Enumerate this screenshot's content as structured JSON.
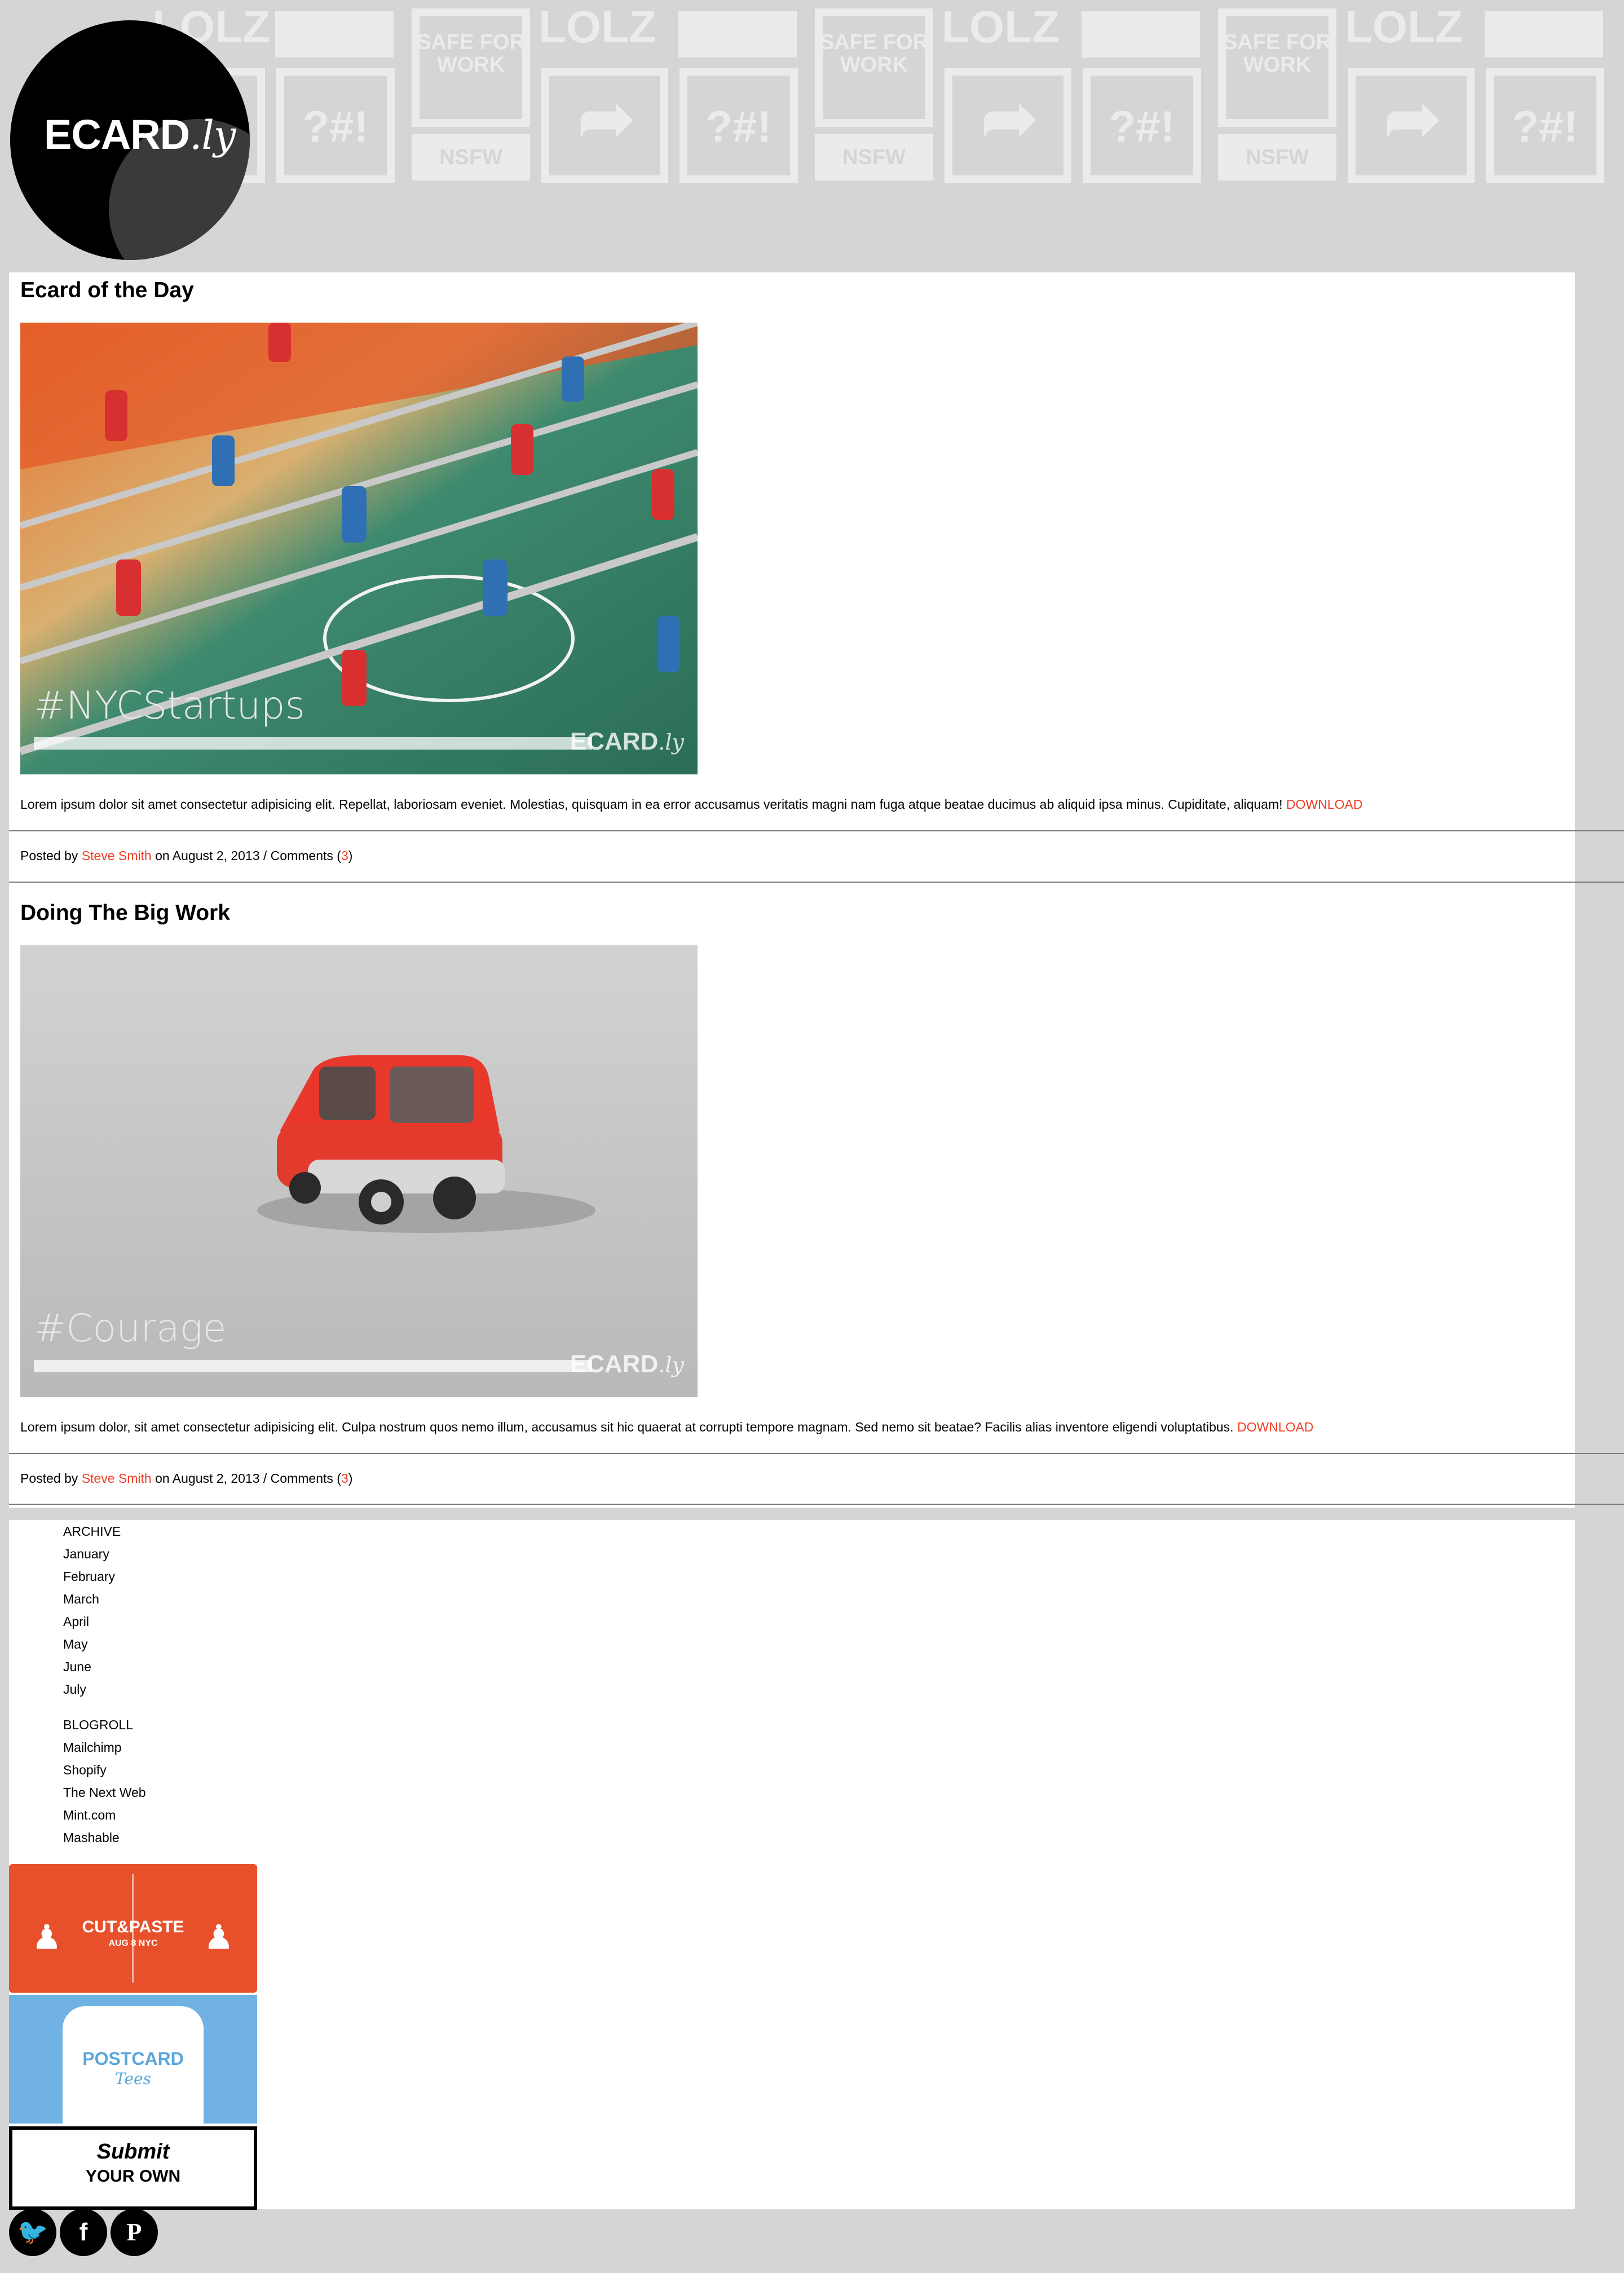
{
  "header": {
    "logo_text": "ECARD",
    "logo_suffix": ".ly",
    "pattern": {
      "lolz": "LOLZ",
      "sfw": "SAFE FOR WORK",
      "nsfw": "NSFW",
      "symbols": "?#!"
    }
  },
  "posts": [
    {
      "title": "Ecard of the Day",
      "image_hashtag": "#NYCStartups",
      "image_watermark": "ECARD",
      "image_watermark_suffix": ".ly",
      "body": "Lorem ipsum dolor sit amet consectetur adipisicing elit. Repellat, laboriosam eveniet. Molestias, quisquam in ea error accusamus veritatis magni nam fuga atque beatae ducimus ab aliquid ipsa minus. Cupiditate, aliquam!",
      "download_label": "DOWNLOAD",
      "meta": {
        "posted_by": "Posted by",
        "author": "Steve Smith",
        "date_text": "on August 2, 2013 / Comments (",
        "comments": "3",
        "close": ")"
      }
    },
    {
      "title": "Doing The Big Work",
      "image_hashtag": "#Courage",
      "image_watermark": "ECARD",
      "image_watermark_suffix": ".ly",
      "body": "Lorem ipsum dolor, sit amet consectetur adipisicing elit. Culpa nostrum quos nemo illum, accusamus sit hic quaerat at corrupti tempore magnam. Sed nemo sit beatae? Facilis alias inventore eligendi voluptatibus.",
      "download_label": "DOWNLOAD",
      "meta": {
        "posted_by": "Posted by",
        "author": "Steve Smith",
        "date_text": "on August 2, 2013 / Comments (",
        "comments": "3",
        "close": ")"
      }
    }
  ],
  "sidebar": {
    "archive": {
      "heading": "ARCHIVE",
      "items": [
        "January",
        "February",
        "March",
        "April",
        "May",
        "June",
        "July"
      ]
    },
    "blogroll": {
      "heading": "BLOGROLL",
      "items": [
        "Mailchimp",
        "Shopify",
        "The Next Web",
        "Mint.com",
        "Mashable"
      ]
    },
    "ads": {
      "cutpaste_title": "CUT&PASTE",
      "cutpaste_sub": "AUG 8 NYC",
      "postcard_title": "POSTCARD",
      "postcard_sub": "Tees",
      "submit_title": "Submit",
      "submit_sub": "YOUR OWN"
    }
  },
  "social": {
    "twitter": "twitter-icon",
    "facebook": "facebook-icon",
    "pinterest": "pinterest-icon"
  },
  "colors": {
    "accent": "#ef3e23",
    "page_bg": "#d5d5d5",
    "panel_bg": "#ffffff",
    "cutpaste_bg": "#e8502c",
    "postcard_bg": "#6fb2e3"
  }
}
